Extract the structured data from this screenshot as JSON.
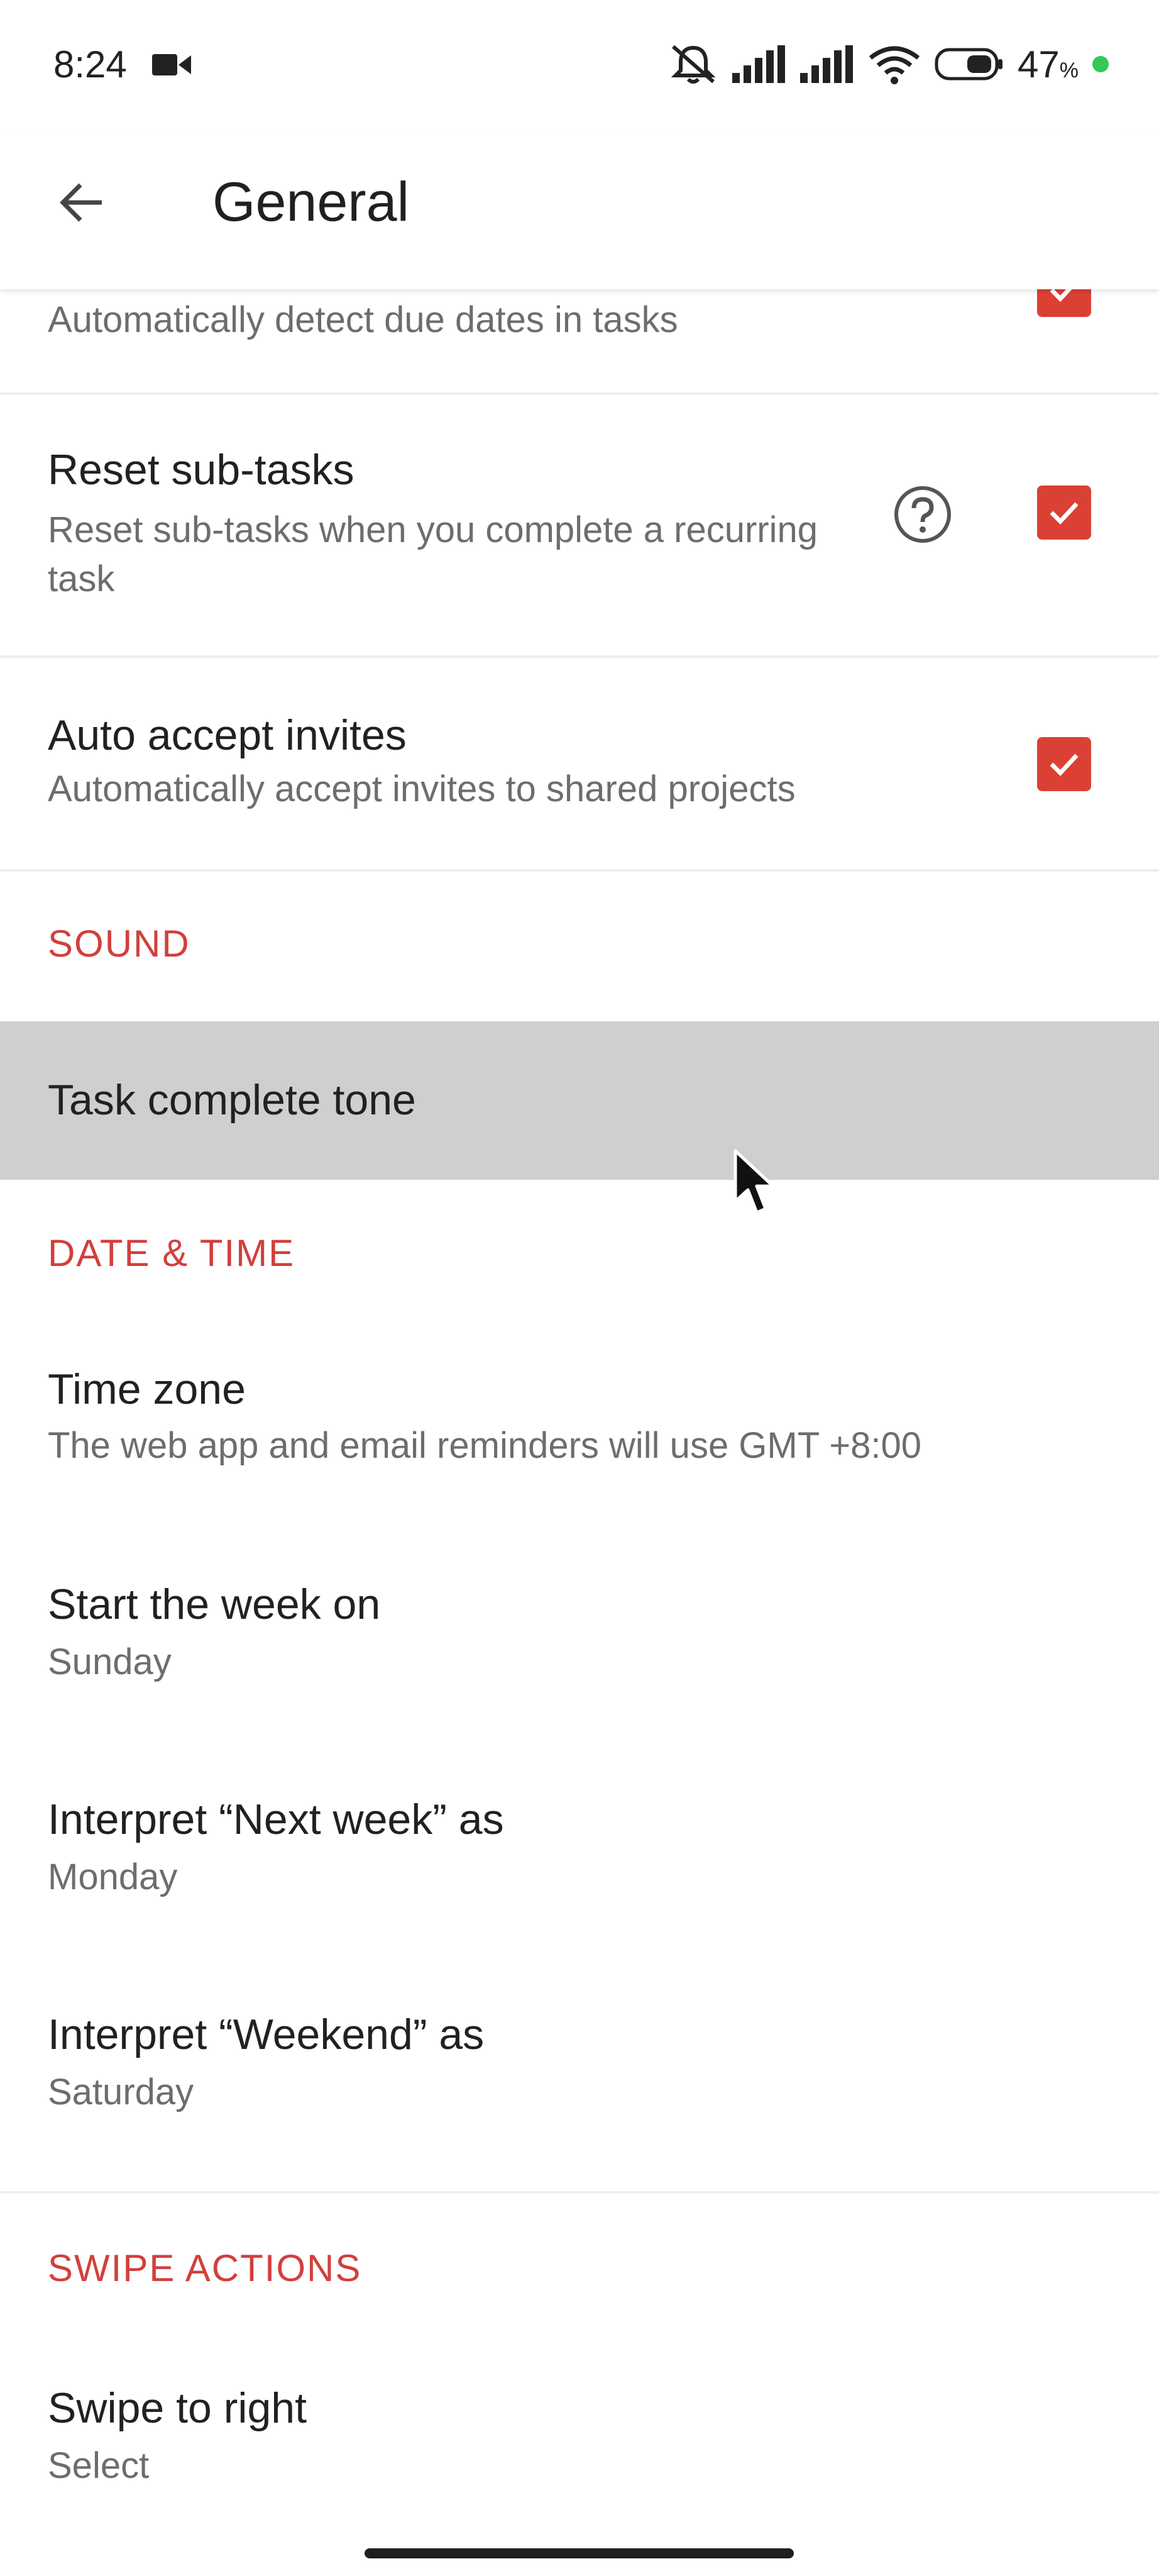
{
  "status_bar": {
    "time": "8:24",
    "battery_percent": "47",
    "battery_unit": "%",
    "icons": [
      "video-icon",
      "silent-icon",
      "signal-icon",
      "signal-icon",
      "wifi-icon",
      "battery-icon"
    ]
  },
  "app_bar": {
    "title": "General"
  },
  "settings": {
    "smart_date": {
      "subtitle": "Automatically detect due dates in tasks",
      "checked": true
    },
    "reset_subtasks": {
      "title": "Reset sub-tasks",
      "subtitle": "Reset sub-tasks when you complete a recurring task",
      "checked": true
    },
    "auto_accept": {
      "title": "Auto accept invites",
      "subtitle": "Automatically accept invites to shared projects",
      "checked": true
    },
    "sound_header": "SOUND",
    "task_complete_tone": {
      "title": "Task complete tone"
    },
    "date_time_header": "DATE & TIME",
    "time_zone": {
      "title": "Time zone",
      "subtitle": "The web app and email reminders will use GMT +8:00"
    },
    "start_week": {
      "title": "Start the week on",
      "subtitle": "Sunday"
    },
    "next_week": {
      "title": "Interpret “Next week” as",
      "subtitle": "Monday"
    },
    "weekend": {
      "title": "Interpret “Weekend” as",
      "subtitle": "Saturday"
    },
    "swipe_header": "SWIPE ACTIONS",
    "swipe_right": {
      "title": "Swipe to right",
      "subtitle": "Select"
    }
  },
  "colors": {
    "accent": "#db4035",
    "section_header": "#d1403c",
    "highlight_row": "#cfcfcf"
  }
}
